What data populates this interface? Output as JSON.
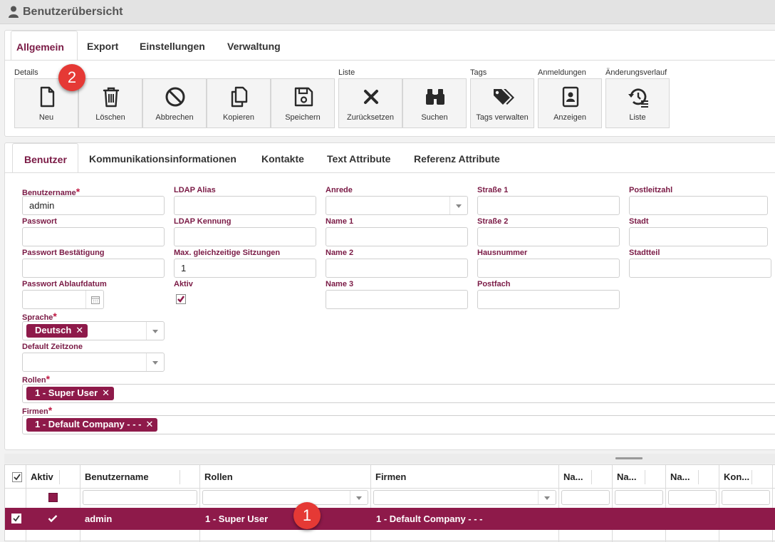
{
  "window": {
    "title": "Benutzerübersicht"
  },
  "main_tabs": [
    "Allgemein",
    "Export",
    "Einstellungen",
    "Verwaltung"
  ],
  "groups": {
    "details": "Details",
    "liste": "Liste",
    "tags": "Tags",
    "anmeldungen": "Anmeldungen",
    "verlauf": "Änderungsverlauf"
  },
  "toolbar": {
    "neu": "Neu",
    "loeschen": "Löschen",
    "abbrechen": "Abbrechen",
    "kopieren": "Kopieren",
    "speichern": "Speichern",
    "zuruecksetzen": "Zurücksetzen",
    "suchen": "Suchen",
    "tags_verwalten": "Tags verwalten",
    "anzeigen": "Anzeigen",
    "liste": "Liste"
  },
  "icons": {
    "neu": "file-new-icon",
    "loeschen": "trash-icon",
    "abbrechen": "cancel-circle-icon",
    "kopieren": "copy-icon",
    "speichern": "floppy-disk-icon",
    "zuruecksetzen": "x-mark-icon",
    "suchen": "binoculars-icon",
    "tags": "tags-icon",
    "anzeigen": "id-card-icon",
    "verlauf": "history-list-icon"
  },
  "badges": [
    "1",
    "2"
  ],
  "form_tabs": [
    "Benutzer",
    "Kommunikationsinformationen",
    "Kontakte",
    "Text Attribute",
    "Referenz Attribute"
  ],
  "form": {
    "benutzername": {
      "label": "Benutzername",
      "required": "*",
      "value": "admin"
    },
    "passwort": {
      "label": "Passwort"
    },
    "passwort_bestaetigung": {
      "label": "Passwort Bestätigung"
    },
    "passwort_ablaufdatum": {
      "label": "Passwort Ablaufdatum"
    },
    "sprache": {
      "label": "Sprache",
      "required": "*",
      "chip": "Deutsch"
    },
    "zeitzone": {
      "label": "Default Zeitzone"
    },
    "rollen": {
      "label": "Rollen",
      "required": "*",
      "chip": "1 - Super User"
    },
    "firmen": {
      "label": "Firmen",
      "required": "*",
      "chip": "1 - Default Company - - -"
    },
    "ldap_alias": {
      "label": "LDAP Alias"
    },
    "ldap_kennung": {
      "label": "LDAP Kennung"
    },
    "max_sitzungen": {
      "label": "Max. gleichzeitige Sitzungen",
      "value": "1"
    },
    "aktiv": {
      "label": "Aktiv",
      "checked": true
    },
    "anrede": {
      "label": "Anrede"
    },
    "name1": {
      "label": "Name 1"
    },
    "name2": {
      "label": "Name 2"
    },
    "name3": {
      "label": "Name 3"
    },
    "strasse1": {
      "label": "Straße 1"
    },
    "strasse2": {
      "label": "Straße 2"
    },
    "hausnummer": {
      "label": "Hausnummer"
    },
    "postfach": {
      "label": "Postfach"
    },
    "plz": {
      "label": "Postleitzahl"
    },
    "stadt": {
      "label": "Stadt"
    },
    "stadtteil": {
      "label": "Stadtteil"
    }
  },
  "grid": {
    "headers": [
      "Aktiv",
      "Benutzername",
      "Rollen",
      "Firmen",
      "Na...",
      "Na...",
      "Na...",
      "Kon..."
    ],
    "row": {
      "benutzername": "admin",
      "rollen": "1 - Super User",
      "firmen": "1 - Default Company - - -"
    }
  },
  "colors": {
    "accent": "#8e1a4a",
    "label": "#7a1a45",
    "badge": "#e53935"
  }
}
